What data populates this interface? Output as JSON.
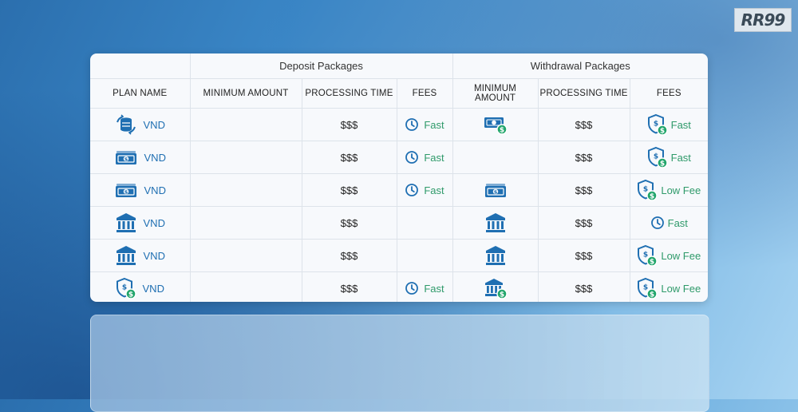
{
  "brand": {
    "logo_text": "RR99"
  },
  "table": {
    "group_headers": [
      "Deposit Packages",
      "Withdrawal Packages"
    ],
    "columns": [
      "PLAN NAME",
      "MINIMUM AMOUNT",
      "PROCESSING TIME",
      "FEES",
      "MINIMUM AMOUNT",
      "PROCESSING TIME",
      "FEES"
    ],
    "rows": [
      {
        "plan_icon": "coin-exchange-icon",
        "plan": "VND",
        "dep_min_icon": "",
        "dep_time": "$$$",
        "dep_fee_icon": "clock-icon",
        "dep_fee": "Fast",
        "wd_min_icon": "cash-coin-icon",
        "wd_time": "$$$",
        "wd_fee_icon": "shield-dollar-icon",
        "wd_fee": "Fast"
      },
      {
        "plan_icon": "banknote-icon",
        "plan": "VND",
        "dep_min_icon": "",
        "dep_time": "$$$",
        "dep_fee_icon": "clock-icon",
        "dep_fee": "Fast",
        "wd_min_icon": "",
        "wd_time": "$$$",
        "wd_fee_icon": "shield-dollar-icon",
        "wd_fee": "Fast"
      },
      {
        "plan_icon": "banknote-icon",
        "plan": "VND",
        "dep_min_icon": "",
        "dep_time": "$$$",
        "dep_fee_icon": "clock-icon",
        "dep_fee": "Fast",
        "wd_min_icon": "banknote-icon",
        "wd_time": "$$$",
        "wd_fee_icon": "shield-dollar-icon",
        "wd_fee": "Low Fee"
      },
      {
        "plan_icon": "bank-icon",
        "plan": "VND",
        "dep_min_icon": "",
        "dep_time": "$$$",
        "dep_fee_icon": "",
        "dep_fee": "",
        "wd_min_icon": "bank-icon",
        "wd_time": "$$$",
        "wd_fee_icon": "clock-icon",
        "wd_fee": "Fast"
      },
      {
        "plan_icon": "bank-icon",
        "plan": "VND",
        "dep_min_icon": "",
        "dep_time": "$$$",
        "dep_fee_icon": "",
        "dep_fee": "",
        "wd_min_icon": "bank-icon",
        "wd_time": "$$$",
        "wd_fee_icon": "shield-dollar-icon",
        "wd_fee": "Low Fee"
      },
      {
        "plan_icon": "shield-dollar-icon",
        "plan": "VND",
        "dep_min_icon": "",
        "dep_time": "$$$",
        "dep_fee_icon": "clock-icon",
        "dep_fee": "Fast",
        "wd_min_icon": "bank-coin-icon",
        "wd_time": "$$$",
        "wd_fee_icon": "shield-dollar-icon",
        "wd_fee": "Low Fee"
      }
    ]
  },
  "colors": {
    "icon_blue": "#1f6fb2",
    "fee_green": "#2f9a6a",
    "coin_green": "#21a56b"
  }
}
